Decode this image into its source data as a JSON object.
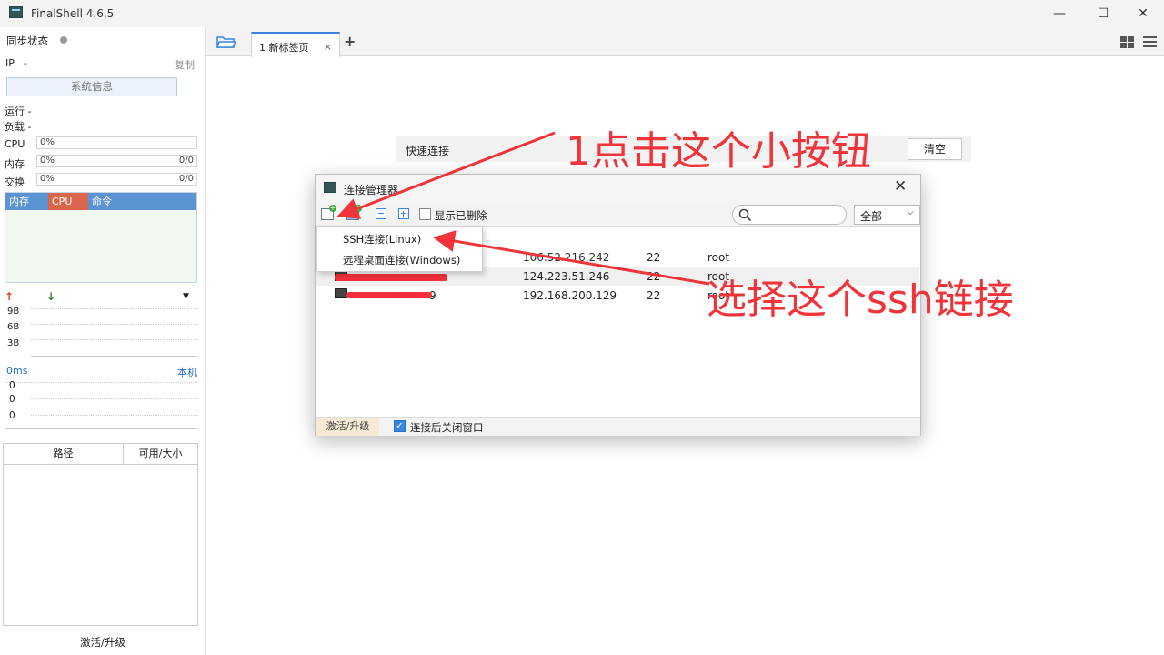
{
  "app": {
    "title": "FinalShell 4.6.5"
  },
  "window_buttons": {
    "minimize": "—",
    "maximize": "☐",
    "close": "✕"
  },
  "sidebar": {
    "sync_status_label": "同步状态",
    "ip_label": "IP",
    "ip_value": "-",
    "copy_label": "复制",
    "sysinfo_button": "系统信息",
    "run_label": "运行 -",
    "load_label": "负载 -",
    "cpu_label": "CPU",
    "cpu_value": "0%",
    "mem_label": "内存",
    "mem_value": "0%",
    "mem_ratio": "0/0",
    "swap_label": "交换",
    "swap_value": "0%",
    "swap_ratio": "0/0",
    "proc_tabs": [
      "内存",
      "CPU",
      "命令"
    ],
    "net_ticks": [
      "9B",
      "6B",
      "3B"
    ],
    "latency_label": "0ms",
    "latency_local": "本机",
    "latency_values": [
      "0",
      "0",
      "0"
    ],
    "path_headers": [
      "路径",
      "可用/大小"
    ],
    "activate_label": "激活/升级"
  },
  "tabs": {
    "items": [
      {
        "label": "1 新标签页"
      }
    ],
    "add_label": "+"
  },
  "quick_connect": {
    "label": "快速连接",
    "clear_button": "清空"
  },
  "dialog": {
    "title": "连接管理器",
    "show_deleted_label": "显示已删除",
    "filter_value": "全部",
    "rows": [
      {
        "ip": "106.52.216.242",
        "port": "22",
        "user": "root"
      },
      {
        "ip": "124.223.51.246",
        "port": "22",
        "user": "root"
      },
      {
        "name_suffix": "9",
        "ip": "192.168.200.129",
        "port": "22",
        "user": "root"
      }
    ],
    "footer_activate": "激活/升级",
    "footer_close_after_connect": "连接后关闭窗口"
  },
  "menu": {
    "items": [
      "SSH连接(Linux)",
      "远程桌面连接(Windows)"
    ]
  },
  "annotations": {
    "note1": "1点击这个小按钮",
    "note2": "选择这个ssh链接"
  },
  "colors": {
    "accent": "#3b84e0",
    "annotation": "#f0343a",
    "process_header": "#5b93d3",
    "cpu_tab": "#d9664a"
  }
}
